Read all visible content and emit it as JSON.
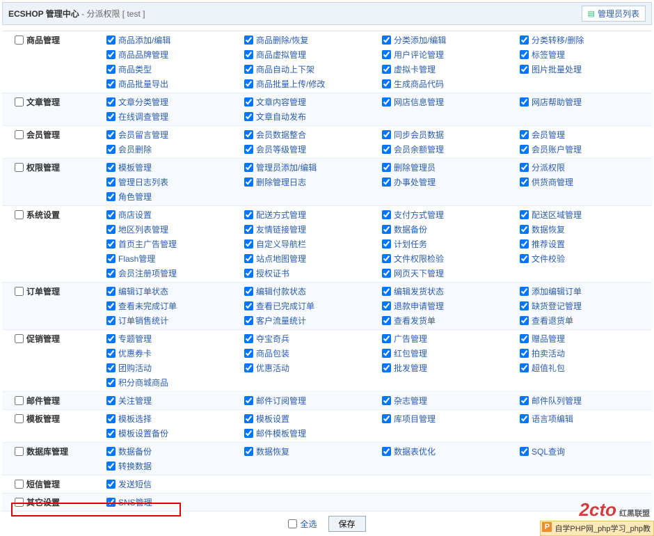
{
  "header": {
    "brand": "ECSHOP 管理中心",
    "subtitle": "- 分派权限 [ test ]",
    "link_label": "管理员列表"
  },
  "sections": [
    {
      "name": "商品管理",
      "cols": [
        [
          "商品添加/编辑",
          "商品品牌管理",
          "商品类型",
          "商品批量导出"
        ],
        [
          "商品删除/恢复",
          "商品虚拟管理",
          "商品自动上下架",
          "商品批量上传/修改"
        ],
        [
          "分类添加/编辑",
          "用户评论管理",
          "虚拟卡管理",
          "生成商品代码"
        ],
        [
          "分类转移/删除",
          "标签管理",
          "图片批量处理"
        ]
      ]
    },
    {
      "name": "文章管理",
      "cols": [
        [
          "文章分类管理",
          "在线调查管理"
        ],
        [
          "文章内容管理",
          "文章自动发布"
        ],
        [
          "网店信息管理"
        ],
        [
          "网店帮助管理"
        ]
      ]
    },
    {
      "name": "会员管理",
      "cols": [
        [
          "会员留言管理",
          "会员删除"
        ],
        [
          "会员数据整合",
          "会员等级管理"
        ],
        [
          "同步会员数据",
          "会员余额管理"
        ],
        [
          "会员管理",
          "会员账户管理"
        ]
      ]
    },
    {
      "name": "权限管理",
      "cols": [
        [
          "模板管理",
          "管理日志列表",
          "角色管理"
        ],
        [
          "管理员添加/编辑",
          "删除管理日志"
        ],
        [
          "删除管理员",
          "办事处管理"
        ],
        [
          "分派权限",
          "供货商管理"
        ]
      ]
    },
    {
      "name": "系统设置",
      "cols": [
        [
          "商店设置",
          "地区列表管理",
          "首页主广告管理",
          "Flash管理",
          "会员注册项管理"
        ],
        [
          "配送方式管理",
          "友情链接管理",
          "自定义导航栏",
          "站点地图管理",
          "授权证书"
        ],
        [
          "支付方式管理",
          "数据备份",
          "计划任务",
          "文件权限检验",
          "网页天下管理"
        ],
        [
          "配送区域管理",
          "数据恢复",
          "推荐设置",
          "文件校验"
        ]
      ]
    },
    {
      "name": "订单管理",
      "cols": [
        [
          "编辑订单状态",
          "查看未完成订单",
          "订单销售统计"
        ],
        [
          "编辑付款状态",
          "查看已完成订单",
          "客户流量统计"
        ],
        [
          "编辑发货状态",
          "退款申请管理",
          "查看发货单"
        ],
        [
          "添加编辑订单",
          "缺货登记管理",
          "查看退货单"
        ]
      ]
    },
    {
      "name": "促销管理",
      "cols": [
        [
          "专题管理",
          "优惠券卡",
          "团购活动",
          "积分商城商品"
        ],
        [
          "夺宝奇兵",
          "商品包装",
          "优惠活动"
        ],
        [
          "广告管理",
          "红包管理",
          "批发管理"
        ],
        [
          "赠品管理",
          "拍卖活动",
          "超值礼包"
        ]
      ]
    },
    {
      "name": "邮件管理",
      "cols": [
        [
          "关注管理"
        ],
        [
          "邮件订阅管理"
        ],
        [
          "杂志管理"
        ],
        [
          "邮件队列管理"
        ]
      ]
    },
    {
      "name": "模板管理",
      "cols": [
        [
          "模板选择",
          "模板设置备份"
        ],
        [
          "模板设置",
          "邮件模板管理"
        ],
        [
          "库项目管理"
        ],
        [
          "语言项编辑"
        ]
      ]
    },
    {
      "name": "数据库管理",
      "cols": [
        [
          "数据备份",
          "转换数据"
        ],
        [
          "数据恢复"
        ],
        [
          "数据表优化"
        ],
        [
          "SQL查询"
        ]
      ]
    },
    {
      "name": "短信管理",
      "cols": [
        [
          "发送短信"
        ],
        [],
        [],
        []
      ]
    },
    {
      "name": "其它设置",
      "cols": [
        [
          "SNS管理"
        ],
        [],
        [],
        []
      ]
    }
  ],
  "footer": {
    "select_all": "全选",
    "save": "保存"
  },
  "watermarks": {
    "w1_main": "2cto",
    "w1_sub": "红黑联盟",
    "w2": "自学PHP网_php学习_php教"
  }
}
